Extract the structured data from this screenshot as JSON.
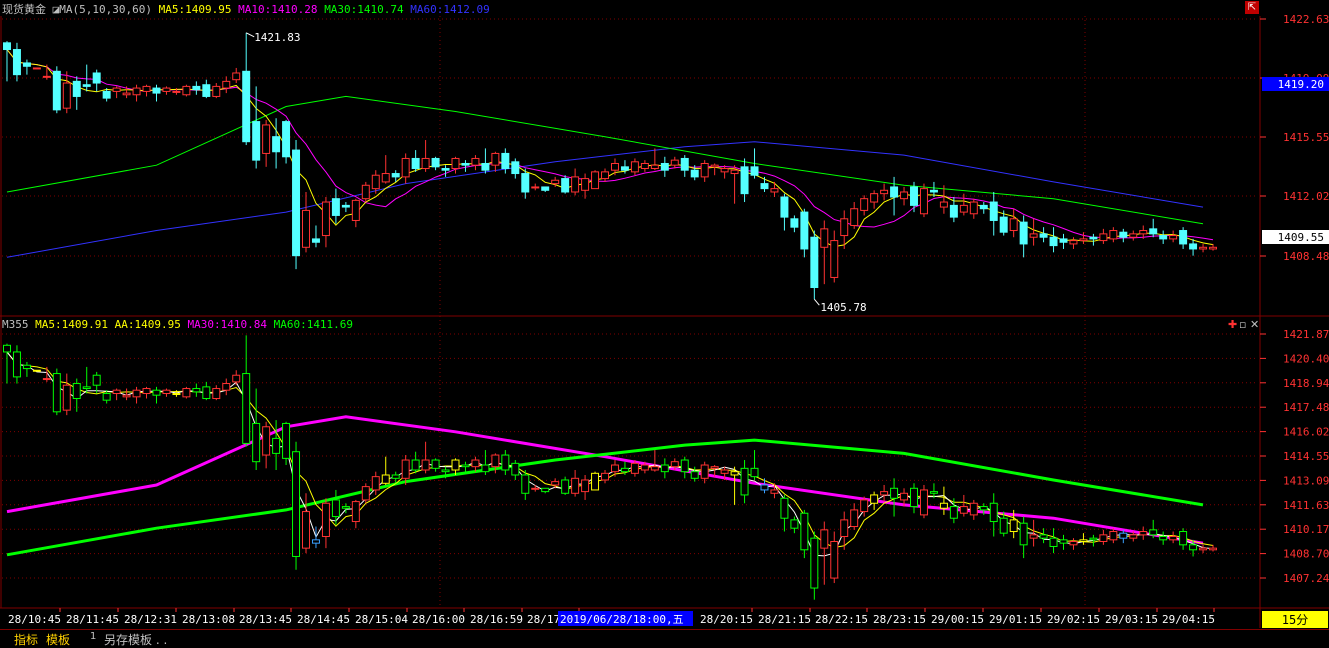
{
  "main_panel": {
    "title": "现货黄金",
    "indicator": "MA(5,10,30,60)",
    "ma5_label": "MA5:1409.95",
    "ma10_label": "MA10:1410.28",
    "ma30_label": "MA30:1410.74",
    "ma60_label": "MA60:1412.09",
    "high_label": "1421.83",
    "low_label": "1405.78",
    "current_price_tag": "1419.20",
    "last_price_tag": "1409.55",
    "y_ticks": [
      "1422.63",
      "1419.09",
      "1415.55",
      "1412.02",
      "1408.48"
    ]
  },
  "sub_panel": {
    "indicator": "M355",
    "ma5_label": "MA5:1409.91",
    "aa_label": "AA:1409.95",
    "ma30_label": "MA30:1410.84",
    "ma60_label": "MA60:1411.69",
    "y_ticks": [
      "1421.87",
      "1420.40",
      "1418.94",
      "1417.48",
      "1416.02",
      "1414.55",
      "1413.09",
      "1411.63",
      "1410.17",
      "1408.70",
      "1407.24"
    ]
  },
  "x_axis": {
    "labels": [
      "28/10:45",
      "28/11:45",
      "28/12:31",
      "28/13:08",
      "28/13:45",
      "28/14:45",
      "28/15:04",
      "28/16:00",
      "28/16:59",
      "28/17",
      "28/20:15",
      "28/21:15",
      "28/22:15",
      "28/23:15",
      "29/00:15",
      "29/01:15",
      "29/02:15",
      "29/03:15",
      "29/04:15"
    ],
    "cursor_label": "2019/06/28/18:00,五",
    "period": "15分"
  },
  "toolbar": {
    "tab_indicator": "指标",
    "tab_template": "模板",
    "number": "1",
    "save_template": "另存模板 . ."
  },
  "colors": {
    "up": "#ff3232",
    "down": "#54ffff",
    "ma5": "#ffffff",
    "ma10": "#ffff00",
    "ma30": "#ff00ff",
    "ma60": "#00ff00",
    "ma120": "#3232ff",
    "grid": "#800000",
    "axis_text": "#ff3232"
  },
  "chart_data": {
    "type": "candlestick",
    "title": "现货黄金",
    "period": "15分",
    "y_range_main": [
      1405.5,
      1423.4
    ],
    "y_range_sub": [
      1406.0,
      1422.6
    ],
    "candles": [
      [
        1421.8,
        1421.4,
        1421.9,
        1419.5
      ],
      [
        1421.4,
        1419.9,
        1421.8,
        1419.5
      ],
      [
        1420.6,
        1420.4,
        1420.8,
        1419.9
      ],
      [
        1420.3,
        1420.3,
        1420.3,
        1420.3
      ],
      [
        1419.8,
        1419.8,
        1420.5,
        1419.6
      ],
      [
        1420.1,
        1417.8,
        1420.4,
        1417.6
      ],
      [
        1417.9,
        1419.4,
        1420.1,
        1417.6
      ],
      [
        1419.5,
        1418.6,
        1419.8,
        1417.8
      ],
      [
        1419.3,
        1419.2,
        1420.5,
        1418.9
      ],
      [
        1420.0,
        1419.4,
        1420.2,
        1418.9
      ],
      [
        1418.9,
        1418.5,
        1419.1,
        1418.3
      ],
      [
        1418.9,
        1419.1,
        1419.2,
        1418.5
      ],
      [
        1418.7,
        1418.8,
        1419.2,
        1418.5
      ],
      [
        1418.7,
        1419.1,
        1419.3,
        1418.3
      ],
      [
        1418.9,
        1419.2,
        1419.3,
        1418.6
      ],
      [
        1419.1,
        1418.8,
        1419.3,
        1418.3
      ],
      [
        1418.9,
        1419.1,
        1419.2,
        1418.7
      ],
      [
        1418.9,
        1418.9,
        1419.1,
        1418.7
      ],
      [
        1418.7,
        1419.2,
        1419.3,
        1418.6
      ],
      [
        1419.2,
        1419.0,
        1419.5,
        1418.7
      ],
      [
        1419.3,
        1418.6,
        1419.6,
        1418.5
      ],
      [
        1418.6,
        1419.2,
        1419.4,
        1418.5
      ],
      [
        1419.1,
        1419.5,
        1419.8,
        1418.8
      ],
      [
        1419.6,
        1420.0,
        1420.3,
        1419.4
      ],
      [
        1420.1,
        1415.9,
        1422.4,
        1415.7
      ],
      [
        1417.1,
        1414.8,
        1419.2,
        1414.3
      ],
      [
        1415.2,
        1416.9,
        1417.2,
        1414.4
      ],
      [
        1416.2,
        1415.3,
        1417.3,
        1414.3
      ],
      [
        1417.1,
        1415.0,
        1417.2,
        1414.6
      ],
      [
        1415.4,
        1409.1,
        1416.0,
        1408.3
      ],
      [
        1409.6,
        1411.8,
        1412.9,
        1409.3
      ],
      [
        1410.1,
        1409.9,
        1410.9,
        1409.6
      ],
      [
        1410.3,
        1412.3,
        1412.6,
        1409.6
      ],
      [
        1412.5,
        1411.5,
        1413.1,
        1411.0
      ],
      [
        1412.1,
        1412.0,
        1412.3,
        1411.7
      ],
      [
        1411.2,
        1412.4,
        1412.5,
        1410.8
      ],
      [
        1412.5,
        1413.3,
        1413.5,
        1412.3
      ],
      [
        1413.1,
        1413.9,
        1414.2,
        1412.8
      ],
      [
        1413.5,
        1414.0,
        1415.1,
        1413.4
      ],
      [
        1414.0,
        1413.8,
        1414.2,
        1413.5
      ],
      [
        1413.8,
        1414.9,
        1415.2,
        1413.4
      ],
      [
        1414.9,
        1414.3,
        1415.4,
        1414.1
      ],
      [
        1414.3,
        1414.9,
        1416.0,
        1414.1
      ],
      [
        1414.9,
        1414.4,
        1415.0,
        1414.2
      ],
      [
        1414.3,
        1414.2,
        1414.5,
        1413.8
      ],
      [
        1414.3,
        1414.9,
        1415.0,
        1414.0
      ],
      [
        1414.6,
        1414.5,
        1414.8,
        1414.1
      ],
      [
        1414.5,
        1414.9,
        1415.1,
        1414.2
      ],
      [
        1414.6,
        1414.2,
        1415.5,
        1414.0
      ],
      [
        1414.5,
        1415.2,
        1415.3,
        1414.1
      ],
      [
        1415.2,
        1414.3,
        1415.5,
        1414.0
      ],
      [
        1414.7,
        1414.0,
        1414.9,
        1413.7
      ],
      [
        1414.0,
        1412.9,
        1414.3,
        1412.5
      ],
      [
        1413.2,
        1413.2,
        1413.4,
        1413.0
      ],
      [
        1413.2,
        1413.0,
        1413.2,
        1412.9
      ],
      [
        1413.4,
        1413.6,
        1413.8,
        1413.2
      ],
      [
        1413.7,
        1412.9,
        1413.9,
        1412.8
      ],
      [
        1412.9,
        1413.8,
        1414.3,
        1412.7
      ],
      [
        1413.0,
        1413.7,
        1414.0,
        1412.5
      ],
      [
        1413.1,
        1414.1,
        1414.2,
        1413.1
      ],
      [
        1413.7,
        1414.1,
        1414.3,
        1413.5
      ],
      [
        1414.2,
        1414.6,
        1414.9,
        1413.9
      ],
      [
        1414.4,
        1414.2,
        1414.8,
        1414.0
      ],
      [
        1414.1,
        1414.7,
        1414.9,
        1413.9
      ],
      [
        1414.3,
        1414.6,
        1414.8,
        1414.1
      ],
      [
        1414.3,
        1414.5,
        1415.5,
        1414.2
      ],
      [
        1414.6,
        1414.2,
        1415.0,
        1413.8
      ],
      [
        1414.5,
        1414.8,
        1415.0,
        1414.3
      ],
      [
        1414.9,
        1414.2,
        1415.1,
        1413.8
      ],
      [
        1414.2,
        1413.8,
        1414.5,
        1413.6
      ],
      [
        1413.8,
        1414.6,
        1414.8,
        1413.5
      ],
      [
        1414.4,
        1414.5,
        1414.6,
        1413.9
      ],
      [
        1414.1,
        1414.3,
        1414.5,
        1413.7
      ],
      [
        1414.0,
        1414.2,
        1414.5,
        1412.2
      ],
      [
        1414.4,
        1412.8,
        1414.9,
        1412.3
      ],
      [
        1414.4,
        1413.9,
        1415.5,
        1413.7
      ],
      [
        1413.4,
        1413.1,
        1413.8,
        1412.9
      ],
      [
        1412.9,
        1413.1,
        1413.5,
        1412.6
      ],
      [
        1412.6,
        1411.4,
        1412.8,
        1410.6
      ],
      [
        1411.3,
        1410.8,
        1411.5,
        1410.5
      ],
      [
        1411.7,
        1409.5,
        1411.9,
        1409.0
      ],
      [
        1410.2,
        1407.2,
        1410.6,
        1406.5
      ],
      [
        1409.6,
        1410.7,
        1411.2,
        1407.4
      ],
      [
        1407.8,
        1410.0,
        1410.6,
        1407.5
      ],
      [
        1410.3,
        1411.3,
        1411.8,
        1409.5
      ],
      [
        1410.9,
        1411.9,
        1412.3,
        1410.7
      ],
      [
        1411.8,
        1412.5,
        1412.7,
        1411.5
      ],
      [
        1412.3,
        1412.8,
        1413.0,
        1411.9
      ],
      [
        1412.8,
        1413.0,
        1413.4,
        1412.4
      ],
      [
        1413.2,
        1412.6,
        1413.8,
        1411.5
      ],
      [
        1412.5,
        1412.9,
        1413.2,
        1412.1
      ],
      [
        1413.2,
        1412.1,
        1413.5,
        1411.7
      ],
      [
        1411.6,
        1413.1,
        1413.4,
        1411.4
      ],
      [
        1413.0,
        1412.9,
        1413.5,
        1412.6
      ],
      [
        1412.0,
        1412.3,
        1413.3,
        1411.6
      ],
      [
        1412.1,
        1411.4,
        1412.6,
        1411.1
      ],
      [
        1411.7,
        1412.1,
        1412.8,
        1411.5
      ],
      [
        1411.6,
        1412.3,
        1412.5,
        1411.3
      ],
      [
        1412.1,
        1411.9,
        1412.3,
        1411.6
      ],
      [
        1412.3,
        1411.2,
        1412.9,
        1410.3
      ],
      [
        1411.4,
        1410.5,
        1411.8,
        1410.3
      ],
      [
        1410.6,
        1411.3,
        1411.9,
        1410.2
      ],
      [
        1411.1,
        1409.8,
        1411.5,
        1409.0
      ],
      [
        1410.2,
        1410.4,
        1411.3,
        1409.7
      ],
      [
        1410.4,
        1410.2,
        1410.8,
        1409.9
      ],
      [
        1410.2,
        1409.7,
        1410.8,
        1409.3
      ],
      [
        1410.1,
        1409.9,
        1410.4,
        1409.5
      ],
      [
        1409.8,
        1410.0,
        1410.2,
        1409.5
      ],
      [
        1410.0,
        1410.1,
        1410.5,
        1409.8
      ],
      [
        1410.2,
        1410.1,
        1410.4,
        1409.7
      ],
      [
        1410.0,
        1410.4,
        1410.7,
        1409.8
      ],
      [
        1410.1,
        1410.6,
        1410.8,
        1409.9
      ],
      [
        1410.5,
        1410.2,
        1410.7,
        1409.9
      ],
      [
        1410.2,
        1410.4,
        1410.6,
        1410.0
      ],
      [
        1410.4,
        1410.6,
        1410.9,
        1410.1
      ],
      [
        1410.7,
        1410.4,
        1411.3,
        1410.2
      ],
      [
        1410.3,
        1410.1,
        1410.6,
        1409.8
      ],
      [
        1410.1,
        1410.3,
        1410.6,
        1409.9
      ],
      [
        1410.6,
        1409.8,
        1410.8,
        1409.5
      ],
      [
        1409.8,
        1409.5,
        1410.1,
        1409.1
      ],
      [
        1409.5,
        1409.6,
        1409.8,
        1409.3
      ],
      [
        1409.5,
        1409.6,
        1409.8,
        1409.4
      ]
    ],
    "series": [
      {
        "name": "MA5",
        "value_last": 1409.95
      },
      {
        "name": "MA10",
        "value_last": 1410.28
      },
      {
        "name": "MA30",
        "value_last": 1410.74
      },
      {
        "name": "MA60",
        "value_last": 1412.09
      }
    ],
    "ma60_path": [
      [
        0,
        1412.9
      ],
      [
        15,
        1414.5
      ],
      [
        28,
        1418.0
      ],
      [
        34,
        1418.6
      ],
      [
        45,
        1417.7
      ],
      [
        60,
        1416.2
      ],
      [
        75,
        1414.6
      ],
      [
        90,
        1413.3
      ],
      [
        105,
        1412.5
      ],
      [
        120,
        1411.0
      ]
    ],
    "ma120_path": [
      [
        0,
        1409.0
      ],
      [
        15,
        1410.6
      ],
      [
        28,
        1411.7
      ],
      [
        40,
        1413.4
      ],
      [
        55,
        1414.7
      ],
      [
        68,
        1415.6
      ],
      [
        75,
        1415.9
      ],
      [
        90,
        1415.1
      ],
      [
        105,
        1413.5
      ],
      [
        120,
        1412.0
      ]
    ]
  }
}
